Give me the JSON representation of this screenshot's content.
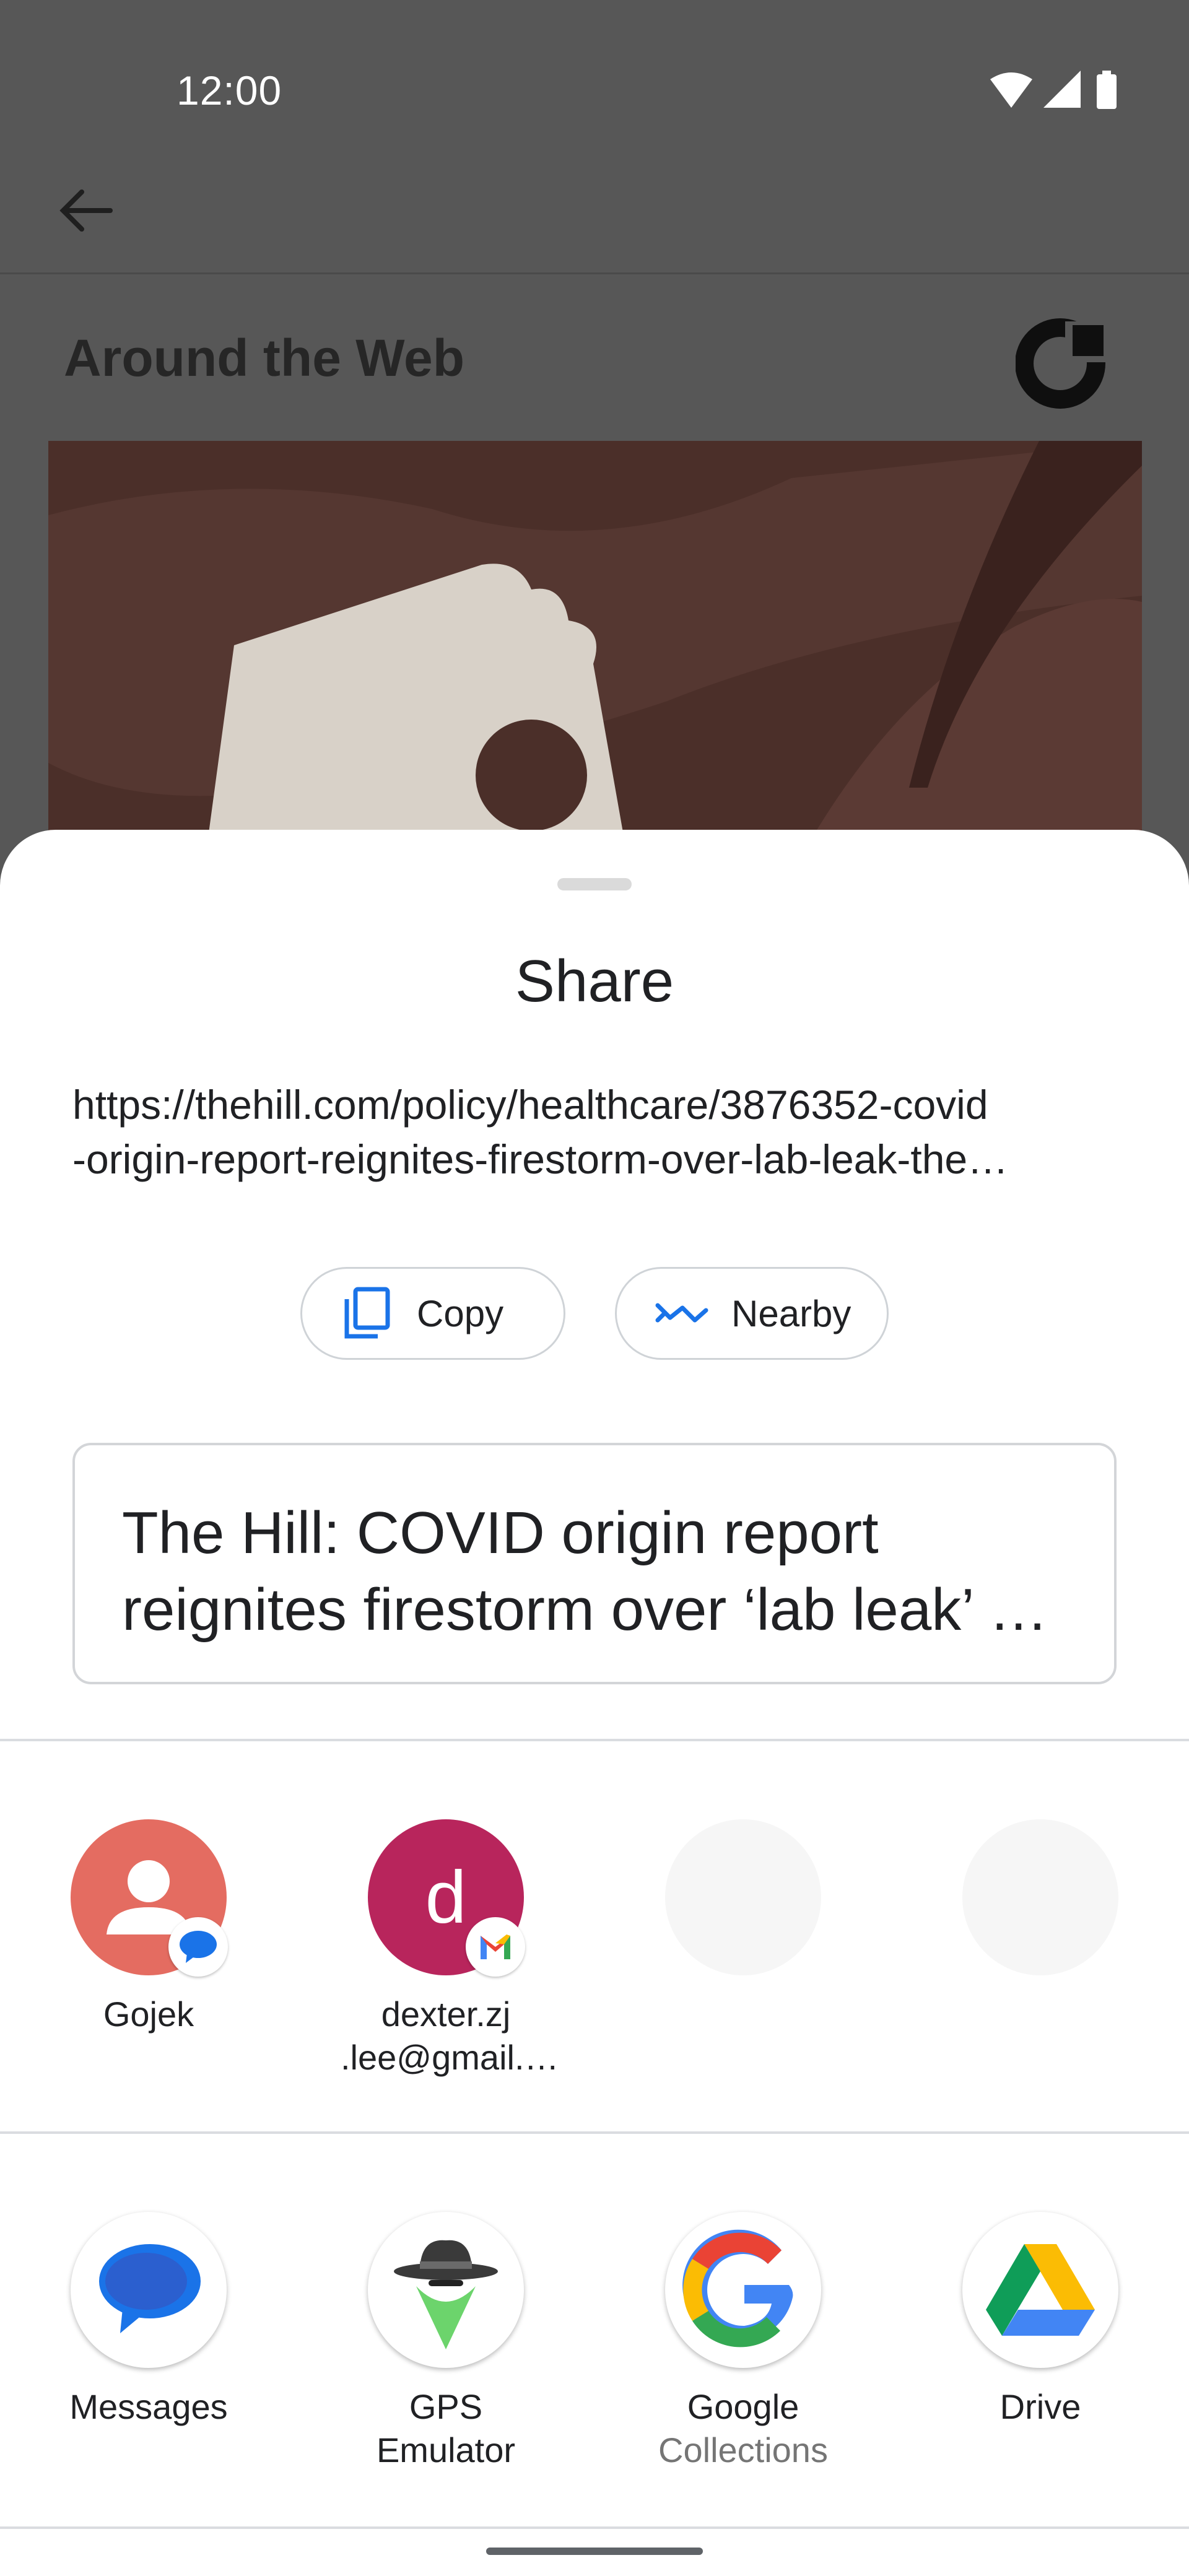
{
  "status_bar": {
    "time": "12:00",
    "icons": [
      "wifi-icon",
      "cell-signal-icon",
      "battery-icon"
    ]
  },
  "background_app": {
    "section_title": "Around the Web",
    "icons": [
      "back-arrow-icon",
      "brand-logo"
    ]
  },
  "share_sheet": {
    "title": "Share",
    "url_lines": [
      "https://thehill.com/policy/healthcare/3876352-covid",
      "-origin-report-reignites-firestorm-over-lab-leak-the…"
    ],
    "actions": [
      {
        "label": "Copy",
        "icon": "copy-icon"
      },
      {
        "label": "Nearby",
        "icon": "nearby-share-icon"
      }
    ],
    "preview_lines": [
      "The Hill: COVID origin report",
      "reignites firestorm over ‘lab leak’ …"
    ],
    "direct_targets": [
      {
        "label": "Gojek",
        "initial": "",
        "badge": "messages-badge-icon",
        "color": "#e46c61"
      },
      {
        "label_lines": [
          "dexter.zj",
          ".lee@gmail.…"
        ],
        "initial": "d",
        "badge": "gmail-badge-icon",
        "color": "#b8255c"
      },
      {
        "label": "",
        "placeholder": true
      },
      {
        "label": "",
        "placeholder": true
      }
    ],
    "apps": [
      {
        "label": "Messages",
        "icon": "messages-app-icon"
      },
      {
        "label": "GPS Emulator",
        "icon": "gps-emulator-app-icon"
      },
      {
        "label": "Google",
        "sublabel": "Collections",
        "icon": "google-app-icon"
      },
      {
        "label": "Drive",
        "icon": "drive-app-icon"
      }
    ]
  },
  "colors": {
    "scrim": "#575757",
    "accent_blue": "#1a73e8",
    "sheet_bg": "#ffffff",
    "text": "#202124"
  }
}
